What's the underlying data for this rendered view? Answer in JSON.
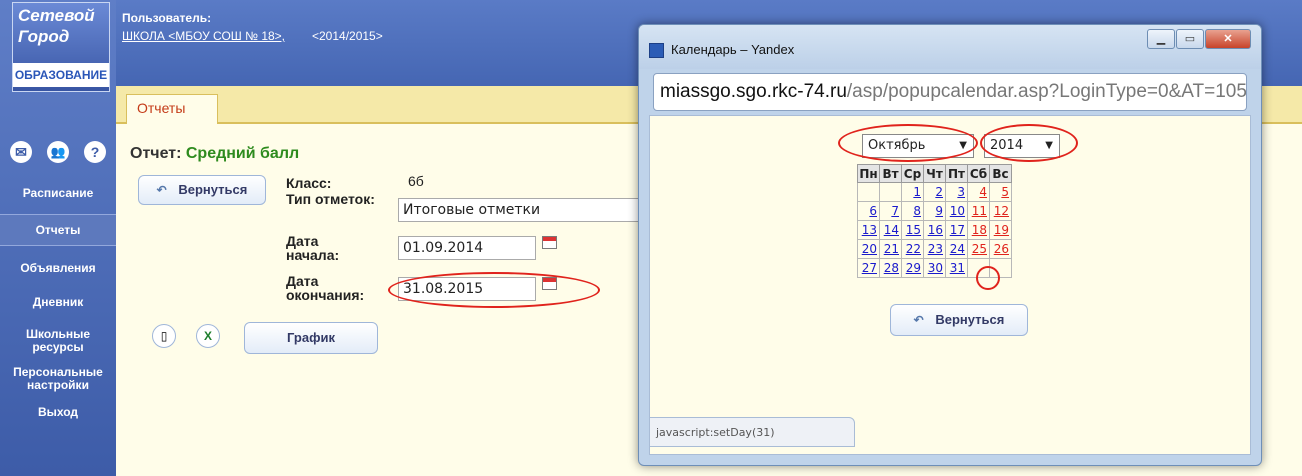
{
  "logo": {
    "line1": "Сетевой",
    "line2": "Город",
    "line3": "ОБРАЗОВАНИЕ"
  },
  "header": {
    "user_label": "Пользователь:",
    "school_link": "ШКОЛА <МБОУ СОШ № 18>,",
    "year": "<2014/2015>"
  },
  "sidebar": {
    "items": [
      {
        "label": "Расписание"
      },
      {
        "label": "Отчеты"
      },
      {
        "label": "Объявления"
      },
      {
        "label": "Дневник"
      },
      {
        "label": "Школьные ресурсы"
      },
      {
        "label": "Персональные настройки"
      },
      {
        "label": "Выход"
      }
    ]
  },
  "tab": {
    "label": "Отчеты"
  },
  "report": {
    "title_prefix": "Отчет:",
    "title_name": "Средний балл",
    "back_button": "Вернуться",
    "class_label": "Класс:",
    "class_value": "6б",
    "mark_type_label": "Тип отметок:",
    "mark_type_value": "Итоговые отметки",
    "start_label_1": "Дата",
    "start_label_2": "начала:",
    "start_value": "01.09.2014",
    "end_label_1": "Дата",
    "end_label_2": "окончания:",
    "end_value": "31.08.2015",
    "chart_button": "График"
  },
  "popup": {
    "title": "Календарь – Yandex",
    "url_domain": "miassgo.sgo.rkc-74.ru",
    "url_path": "/asp/popupcalendar.asp?LoginType=0&AT=105",
    "month": "Октябрь",
    "year": "2014",
    "weekdays": [
      "Пн",
      "Вт",
      "Ср",
      "Чт",
      "Пт",
      "Сб",
      "Вс"
    ],
    "weeks": [
      [
        "",
        "",
        "1",
        "2",
        "3",
        "4",
        "5"
      ],
      [
        "6",
        "7",
        "8",
        "9",
        "10",
        "11",
        "12"
      ],
      [
        "13",
        "14",
        "15",
        "16",
        "17",
        "18",
        "19"
      ],
      [
        "20",
        "21",
        "22",
        "23",
        "24",
        "25",
        "26"
      ],
      [
        "27",
        "28",
        "29",
        "30",
        "31",
        "",
        ""
      ]
    ],
    "back_button": "Вернуться",
    "status": "javascript:setDay(31)"
  },
  "colors": {
    "accent": "#4a6cb8",
    "highlight": "#e0231c",
    "page_bg": "#fffde9",
    "tab_bg": "#f5e9a8"
  }
}
